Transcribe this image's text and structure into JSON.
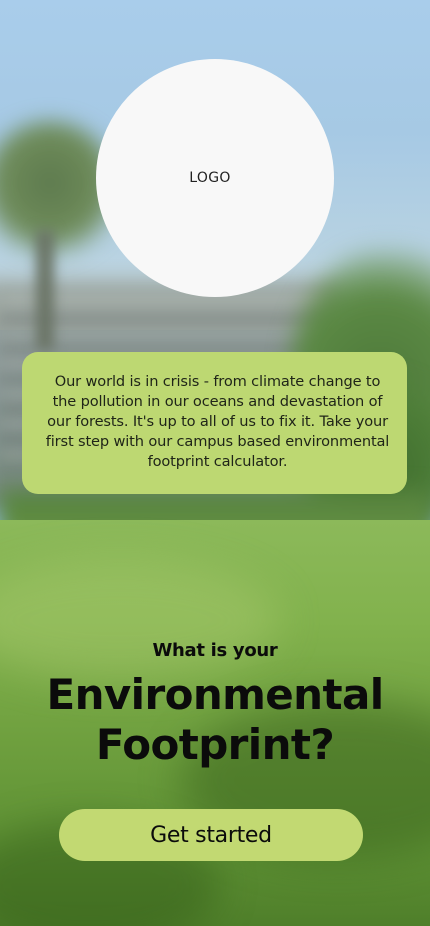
{
  "logo": {
    "text": "LOGO"
  },
  "intro": {
    "text": "Our world is in crisis - from climate change to the pollution in our oceans and devastation of our forests. It's up to all of us to fix it. Take your first step with our campus based environmental footprint calculator."
  },
  "hero": {
    "subheading": "What is your",
    "title_line1": "Environmental",
    "title_line2": "Footprint?"
  },
  "cta": {
    "label": "Get started"
  },
  "colors": {
    "accent": "#bdd872",
    "logo_bg": "#f8f8f8",
    "text": "#0b0b0b"
  }
}
